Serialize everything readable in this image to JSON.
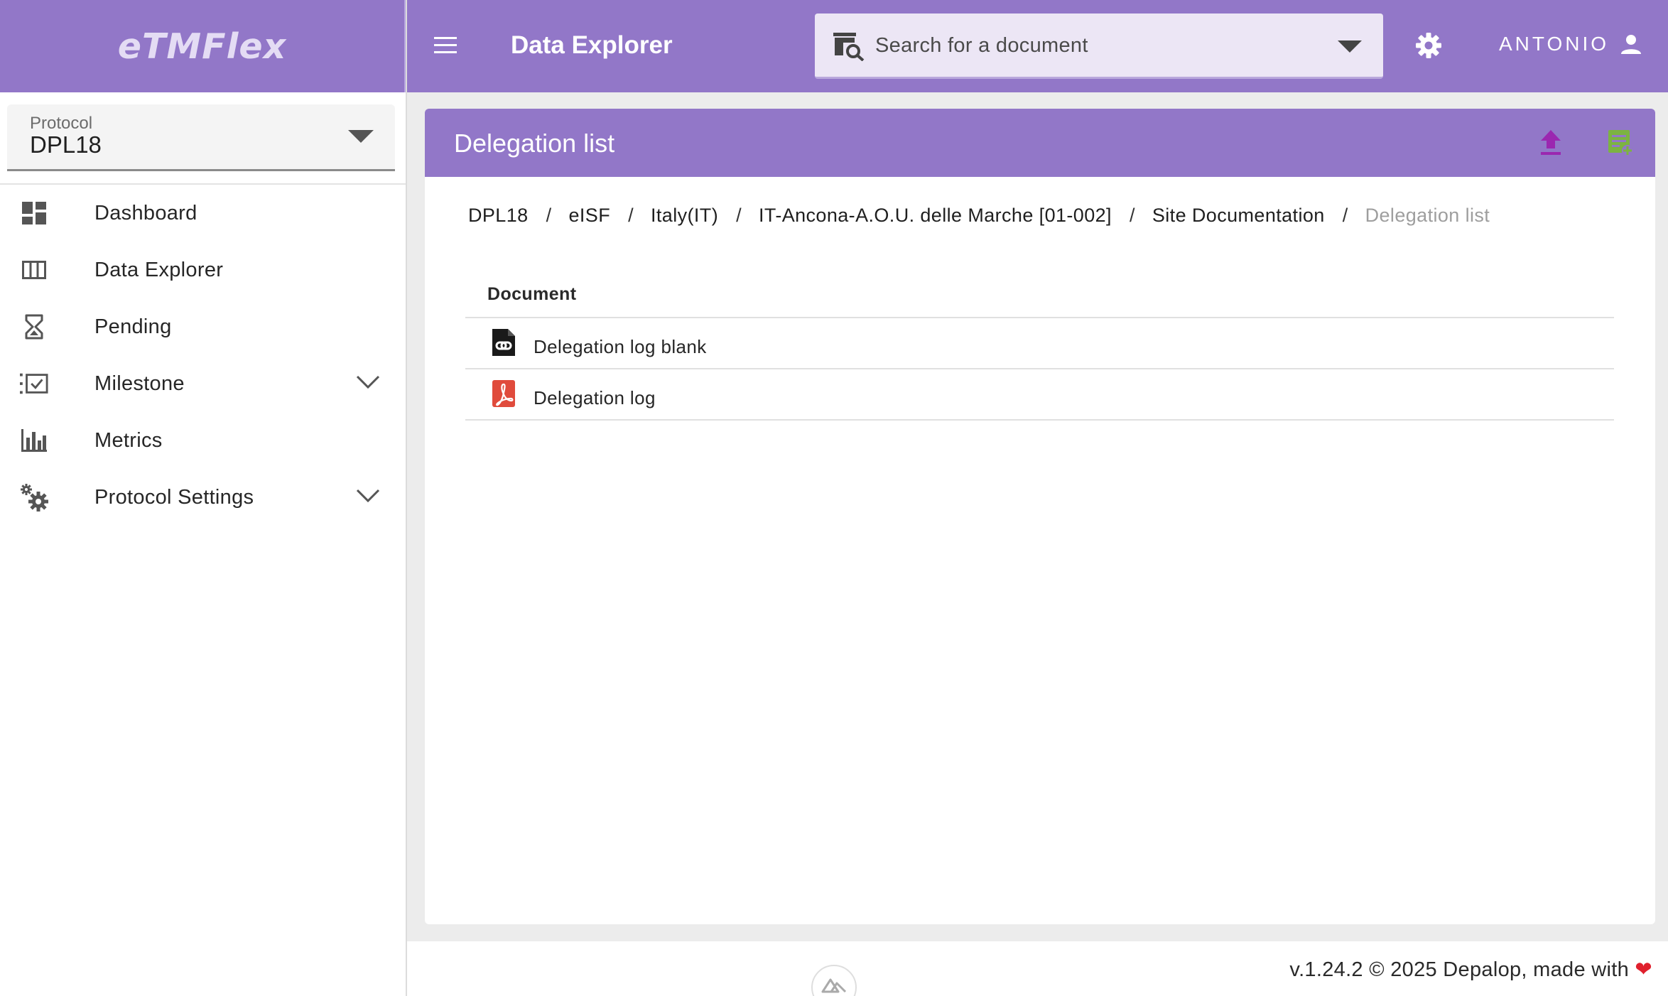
{
  "brand": {
    "name": "eTMFlex"
  },
  "sidebar": {
    "protocol": {
      "label": "Protocol",
      "value": "DPL18"
    },
    "items": [
      {
        "label": "Dashboard",
        "icon": "dashboard-icon",
        "expandable": false
      },
      {
        "label": "Data Explorer",
        "icon": "columns-icon",
        "expandable": false
      },
      {
        "label": "Pending",
        "icon": "hourglass-icon",
        "expandable": false
      },
      {
        "label": "Milestone",
        "icon": "milestone-checklist-icon",
        "expandable": true
      },
      {
        "label": "Metrics",
        "icon": "bar-chart-icon",
        "expandable": false
      },
      {
        "label": "Protocol Settings",
        "icon": "cogs-icon",
        "expandable": true
      }
    ]
  },
  "topbar": {
    "title": "Data Explorer",
    "search_placeholder": "Search for a document",
    "user": "ANTONIO"
  },
  "card": {
    "title": "Delegation list",
    "breadcrumb": [
      "DPL18",
      "eISF",
      "Italy(IT)",
      "IT-Ancona-A.O.U. delle Marche [01-002]",
      "Site Documentation"
    ],
    "breadcrumb_current": "Delegation list",
    "breadcrumb_separator": "/",
    "table": {
      "header": "Document",
      "rows": [
        {
          "name": "Delegation log blank",
          "icon": "file-link-icon"
        },
        {
          "name": "Delegation log",
          "icon": "pdf-icon"
        }
      ]
    }
  },
  "footer": {
    "text": "v.1.24.2 © 2025 Depalop, made with",
    "heart": "❤"
  },
  "colors": {
    "primary": "#9277c8",
    "upload_icon": "#9b27b0",
    "add_icon": "#7cb342",
    "pdf_icon": "#e04b3c"
  }
}
